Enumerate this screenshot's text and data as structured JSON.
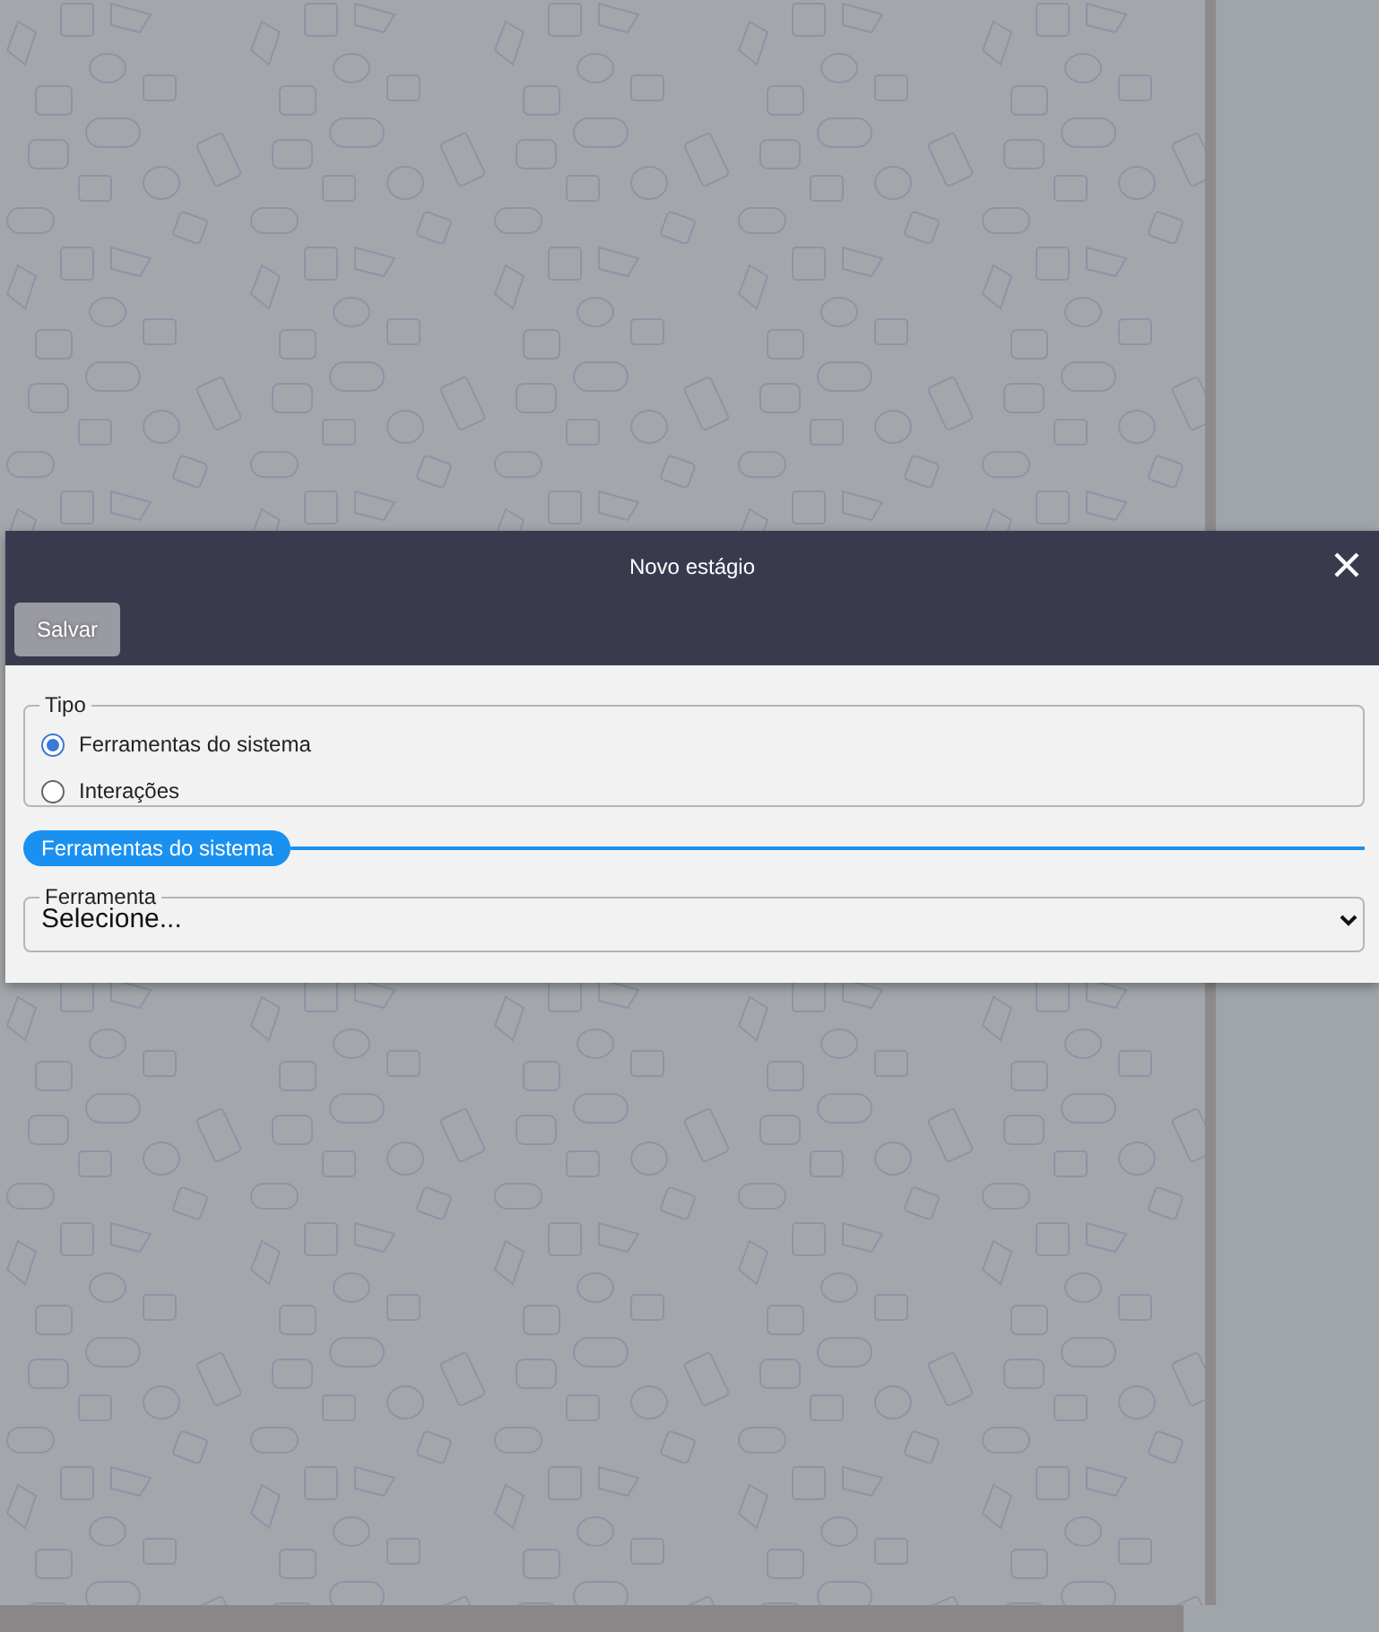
{
  "dialog": {
    "title": "Novo estágio",
    "save_button": "Salvar",
    "type_group": {
      "legend": "Tipo",
      "options": [
        {
          "label": "Ferramentas do sistema",
          "selected": true
        },
        {
          "label": "Interações",
          "selected": false
        }
      ]
    },
    "section": {
      "title": "Ferramentas do sistema"
    },
    "tool_field": {
      "legend": "Ferramenta",
      "value": "Selecione..."
    }
  }
}
